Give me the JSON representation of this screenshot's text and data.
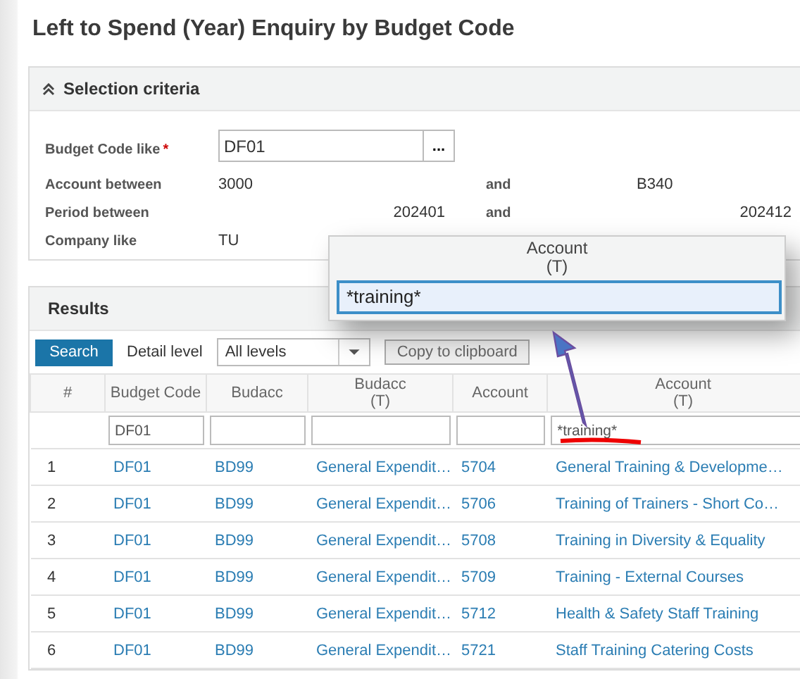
{
  "page": {
    "title": "Left to Spend (Year) Enquiry by Budget Code"
  },
  "selection": {
    "title": "Selection criteria",
    "expanded": true,
    "budget_code": {
      "label": "Budget Code like",
      "required_mark": "*",
      "value": "DF01",
      "lookup": "..."
    },
    "ranges": [
      {
        "kind": "code",
        "label": "Account between",
        "from": "3000",
        "and": "and",
        "to": "B340"
      },
      {
        "kind": "period",
        "label": "Period between",
        "from": "202401",
        "and": "and",
        "to": "202412"
      }
    ],
    "company": {
      "label": "Company like",
      "value": "TU"
    }
  },
  "results": {
    "title": "Results",
    "search_button": "Search",
    "detail_label": "Detail level",
    "detail_value": "All levels",
    "copy_button": "Copy to clipboard",
    "columns": [
      {
        "label": "#"
      },
      {
        "label": "Budget Code"
      },
      {
        "label": "Budacc"
      },
      {
        "label": "Budacc\n(T)"
      },
      {
        "label": "Account"
      },
      {
        "label": "Account\n(T)"
      }
    ],
    "filters": [
      {
        "kind": "text",
        "value": "DF01"
      },
      {
        "kind": "empty"
      },
      {
        "kind": "empty"
      },
      {
        "kind": "empty"
      },
      {
        "kind": "text",
        "value": "*training*"
      }
    ],
    "rows": [
      {
        "n": "1",
        "budget_code": "DF01",
        "budacc": "BD99",
        "budacc_t": "General Expendit…",
        "account": "5704",
        "account_t": "General Training & Developme…"
      },
      {
        "n": "2",
        "budget_code": "DF01",
        "budacc": "BD99",
        "budacc_t": "General Expendit…",
        "account": "5706",
        "account_t": "Training of Trainers - Short Co…"
      },
      {
        "n": "3",
        "budget_code": "DF01",
        "budacc": "BD99",
        "budacc_t": "General Expendit…",
        "account": "5708",
        "account_t": "Training in Diversity & Equality"
      },
      {
        "n": "4",
        "budget_code": "DF01",
        "budacc": "BD99",
        "budacc_t": "General Expendit…",
        "account": "5709",
        "account_t": "Training - External Courses"
      },
      {
        "n": "5",
        "budget_code": "DF01",
        "budacc": "BD99",
        "budacc_t": "General Expendit…",
        "account": "5712",
        "account_t": "Health & Safety Staff Training"
      },
      {
        "n": "6",
        "budget_code": "DF01",
        "budacc": "BD99",
        "budacc_t": "General Expendit…",
        "account": "5721",
        "account_t": "Staff Training Catering Costs"
      }
    ]
  },
  "zoom_callout": {
    "header": "Account\n(T)",
    "value": "*training*"
  }
}
